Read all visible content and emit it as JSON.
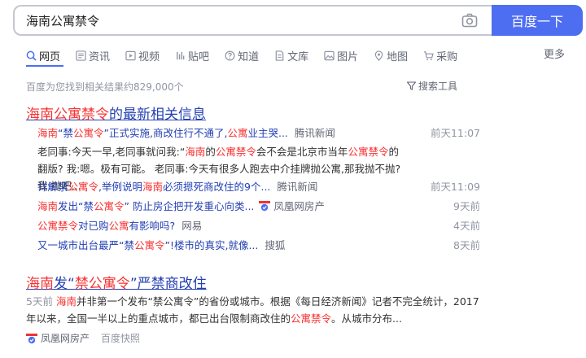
{
  "search": {
    "query": "海南公寓禁令",
    "button_label": "百度一下"
  },
  "tabs": [
    {
      "label": "网页",
      "icon": "search-icon"
    },
    {
      "label": "资讯",
      "icon": "news-icon"
    },
    {
      "label": "视频",
      "icon": "video-icon"
    },
    {
      "label": "贴吧",
      "icon": "tieba-icon"
    },
    {
      "label": "知道",
      "icon": "question-icon"
    },
    {
      "label": "文库",
      "icon": "document-icon"
    },
    {
      "label": "图片",
      "icon": "image-icon"
    },
    {
      "label": "地图",
      "icon": "map-pin-icon"
    },
    {
      "label": "采购",
      "icon": "cart-icon"
    }
  ],
  "more_label": "更多",
  "result_count": "百度为您找到相关结果约829,000个",
  "tools_label": "搜索工具",
  "result1": {
    "title_em": "海南公寓禁令",
    "title_rest": "的最新相关信息",
    "rows": [
      {
        "h0": "海南",
        "h1": "“禁",
        "h2": "公寓令",
        "h3": "”正式实施,商改住行不通了,",
        "h4": "公寓",
        "h5": "业主哭...",
        "source": "腾讯新闻",
        "time": "前天11:07"
      },
      {
        "h0": "详解禁",
        "h1": "公寓令",
        "h2": ",举例说明",
        "h3": "海南",
        "h4": "必须摁死商改住的9个...",
        "source": "腾讯新闻",
        "time": "前天11:09"
      },
      {
        "h0": "海南",
        "h1": "发出“禁",
        "h2": "公寓令",
        "h3": "” 防止房企把开发重心向类...",
        "source": "凤凰网房产",
        "time": "9天前"
      },
      {
        "h0": "公寓禁令",
        "h1": "对已购",
        "h2": "公寓",
        "h3": "有影响吗?",
        "source": "网易",
        "time": "4天前"
      },
      {
        "h0": "又一城市出台最严“禁",
        "h1": "公寓令",
        "h2": "”!楼市的真实,就像...",
        "source": "搜狐",
        "time": "8天前"
      }
    ],
    "snippet": {
      "a": "老同事:今天一早,老同事就问我:“",
      "b": "海南",
      "c": "的",
      "d": "公寓禁令",
      "e": "会不会是北京市当年",
      "f": "公寓禁令",
      "g": "的翻版? 我:嗯。极有可能。 老同事:今天有很多人跑去中介挂牌抛公寓,那我抛不抛? 我:抛吧..."
    }
  },
  "result2": {
    "title_a": "海南",
    "title_b": "发“",
    "title_c": "禁公寓令",
    "title_d": "”严禁商改住",
    "snippet": {
      "date": "5天前",
      "a": "海南",
      "b": "并非第一个发布“禁公寓令”的省份或城市。根据《每日经济新闻》记者不完全统计，2017年以来，全国一半以上的重点城市，都已出台限制商改住的",
      "c": "公寓禁令",
      "d": "。从城市分布..."
    },
    "source": "凤凰网房产",
    "kuaizhao": "百度快照"
  },
  "colors": {
    "accent": "#4e6ef2",
    "link": "#2440b3",
    "highlight": "#f73131",
    "muted": "#9195a3"
  }
}
